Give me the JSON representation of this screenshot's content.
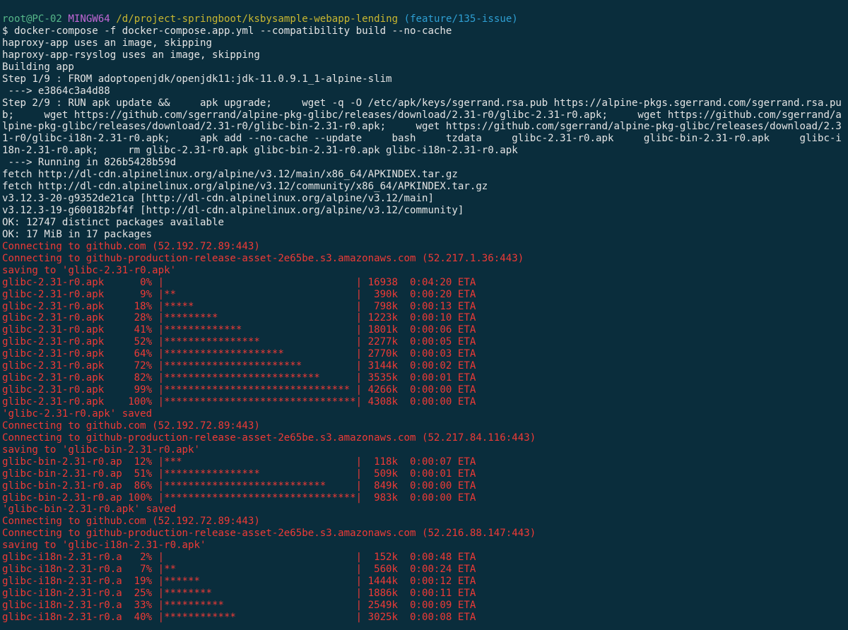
{
  "prompt": {
    "user_host": "root@PC-02",
    "shell": "MINGW64",
    "path": "/d/project-springboot/ksbysample-webapp-lending",
    "branch": "(feature/135-issue)"
  },
  "lines": [
    {
      "c": "w",
      "t": "$ docker-compose -f docker-compose.app.yml --compatibility build --no-cache"
    },
    {
      "c": "w",
      "t": "haproxy-app uses an image, skipping"
    },
    {
      "c": "w",
      "t": "haproxy-app-rsyslog uses an image, skipping"
    },
    {
      "c": "w",
      "t": "Building app"
    },
    {
      "c": "w",
      "t": "Step 1/9 : FROM adoptopenjdk/openjdk11:jdk-11.0.9.1_1-alpine-slim"
    },
    {
      "c": "w",
      "t": " ---> e3864c3a4d88"
    },
    {
      "c": "w",
      "t": "Step 2/9 : RUN apk update &&     apk upgrade;     wget -q -O /etc/apk/keys/sgerrand.rsa.pub https://alpine-pkgs.sgerrand.com/sgerrand.rsa.pu"
    },
    {
      "c": "w",
      "t": "b;     wget https://github.com/sgerrand/alpine-pkg-glibc/releases/download/2.31-r0/glibc-2.31-r0.apk;     wget https://github.com/sgerrand/a"
    },
    {
      "c": "w",
      "t": "lpine-pkg-glibc/releases/download/2.31-r0/glibc-bin-2.31-r0.apk;     wget https://github.com/sgerrand/alpine-pkg-glibc/releases/download/2.3"
    },
    {
      "c": "w",
      "t": "1-r0/glibc-i18n-2.31-r0.apk;     apk add --no-cache --update     bash     tzdata     glibc-2.31-r0.apk     glibc-bin-2.31-r0.apk     glibc-i"
    },
    {
      "c": "w",
      "t": "18n-2.31-r0.apk;     rm glibc-2.31-r0.apk glibc-bin-2.31-r0.apk glibc-i18n-2.31-r0.apk"
    },
    {
      "c": "w",
      "t": " ---> Running in 826b5428b59d"
    },
    {
      "c": "w",
      "t": "fetch http://dl-cdn.alpinelinux.org/alpine/v3.12/main/x86_64/APKINDEX.tar.gz"
    },
    {
      "c": "w",
      "t": "fetch http://dl-cdn.alpinelinux.org/alpine/v3.12/community/x86_64/APKINDEX.tar.gz"
    },
    {
      "c": "w",
      "t": "v3.12.3-20-g9352de21ca [http://dl-cdn.alpinelinux.org/alpine/v3.12/main]"
    },
    {
      "c": "w",
      "t": "v3.12.3-19-g600182bf4f [http://dl-cdn.alpinelinux.org/alpine/v3.12/community]"
    },
    {
      "c": "w",
      "t": "OK: 12747 distinct packages available"
    },
    {
      "c": "w",
      "t": "OK: 17 MiB in 17 packages"
    },
    {
      "c": "r",
      "t": "Connecting to github.com (52.192.72.89:443)"
    },
    {
      "c": "r",
      "t": "Connecting to github-production-release-asset-2e65be.s3.amazonaws.com (52.217.1.36:443)"
    },
    {
      "c": "r",
      "t": "saving to 'glibc-2.31-r0.apk'"
    },
    {
      "c": "r",
      "t": "glibc-2.31-r0.apk      0% |                                | 16938  0:04:20 ETA"
    },
    {
      "c": "r",
      "t": "glibc-2.31-r0.apk      9% |**                              |  390k  0:00:20 ETA"
    },
    {
      "c": "r",
      "t": "glibc-2.31-r0.apk     18% |*****                           |  798k  0:00:13 ETA"
    },
    {
      "c": "r",
      "t": "glibc-2.31-r0.apk     28% |*********                       | 1223k  0:00:10 ETA"
    },
    {
      "c": "r",
      "t": "glibc-2.31-r0.apk     41% |*************                   | 1801k  0:00:06 ETA"
    },
    {
      "c": "r",
      "t": "glibc-2.31-r0.apk     52% |****************                | 2277k  0:00:05 ETA"
    },
    {
      "c": "r",
      "t": "glibc-2.31-r0.apk     64% |********************            | 2770k  0:00:03 ETA"
    },
    {
      "c": "r",
      "t": "glibc-2.31-r0.apk     72% |***********************         | 3144k  0:00:02 ETA"
    },
    {
      "c": "r",
      "t": "glibc-2.31-r0.apk     82% |**************************      | 3535k  0:00:01 ETA"
    },
    {
      "c": "r",
      "t": "glibc-2.31-r0.apk     99% |******************************* | 4266k  0:00:00 ETA"
    },
    {
      "c": "r",
      "t": "glibc-2.31-r0.apk    100% |********************************| 4308k  0:00:00 ETA"
    },
    {
      "c": "r",
      "t": "'glibc-2.31-r0.apk' saved"
    },
    {
      "c": "r",
      "t": "Connecting to github.com (52.192.72.89:443)"
    },
    {
      "c": "r",
      "t": "Connecting to github-production-release-asset-2e65be.s3.amazonaws.com (52.217.84.116:443)"
    },
    {
      "c": "r",
      "t": "saving to 'glibc-bin-2.31-r0.apk'"
    },
    {
      "c": "r",
      "t": "glibc-bin-2.31-r0.ap  12% |***                             |  118k  0:00:07 ETA"
    },
    {
      "c": "r",
      "t": "glibc-bin-2.31-r0.ap  51% |****************                |  509k  0:00:01 ETA"
    },
    {
      "c": "r",
      "t": "glibc-bin-2.31-r0.ap  86% |***************************     |  849k  0:00:00 ETA"
    },
    {
      "c": "r",
      "t": "glibc-bin-2.31-r0.ap 100% |********************************|  983k  0:00:00 ETA"
    },
    {
      "c": "r",
      "t": "'glibc-bin-2.31-r0.apk' saved"
    },
    {
      "c": "r",
      "t": "Connecting to github.com (52.192.72.89:443)"
    },
    {
      "c": "r",
      "t": "Connecting to github-production-release-asset-2e65be.s3.amazonaws.com (52.216.88.147:443)"
    },
    {
      "c": "r",
      "t": "saving to 'glibc-i18n-2.31-r0.apk'"
    },
    {
      "c": "r",
      "t": "glibc-i18n-2.31-r0.a   2% |                                |  152k  0:00:48 ETA"
    },
    {
      "c": "r",
      "t": "glibc-i18n-2.31-r0.a   7% |**                              |  560k  0:00:24 ETA"
    },
    {
      "c": "r",
      "t": "glibc-i18n-2.31-r0.a  19% |******                          | 1444k  0:00:12 ETA"
    },
    {
      "c": "r",
      "t": "glibc-i18n-2.31-r0.a  25% |********                        | 1886k  0:00:11 ETA"
    },
    {
      "c": "r",
      "t": "glibc-i18n-2.31-r0.a  33% |**********                      | 2549k  0:00:09 ETA"
    },
    {
      "c": "r",
      "t": "glibc-i18n-2.31-r0.a  40% |************                    | 3025k  0:00:08 ETA"
    }
  ]
}
